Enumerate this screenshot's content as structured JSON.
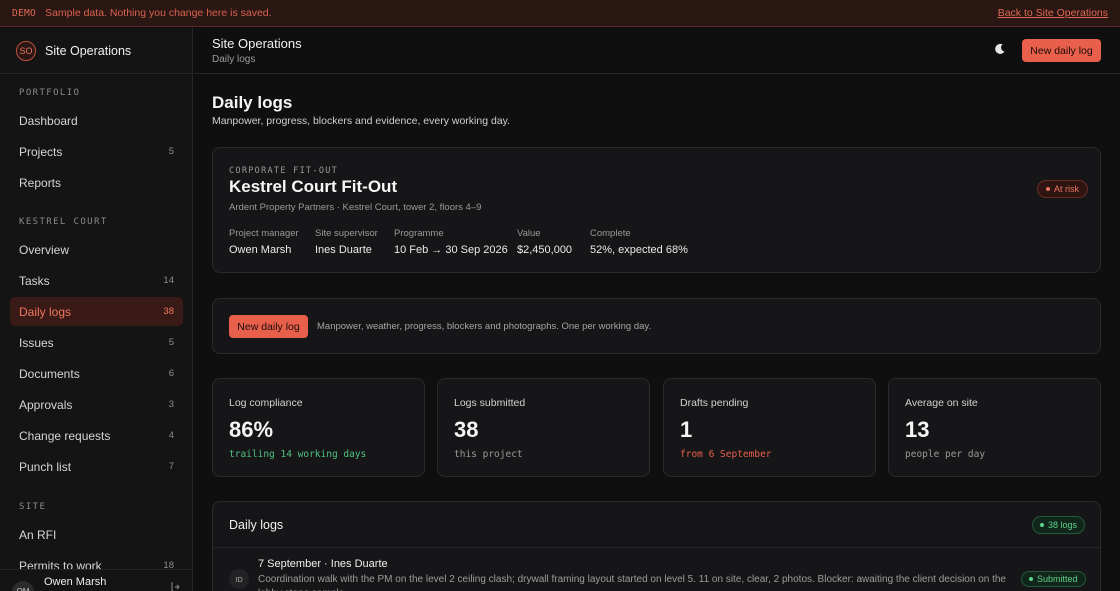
{
  "banner": {
    "tag": "DEMO",
    "message": "Sample data. Nothing you change here is saved.",
    "back_link": "Back to Site Operations"
  },
  "sidebar": {
    "logo_initials": "SO",
    "brand": "Site Operations",
    "sections": [
      {
        "label": "PORTFOLIO",
        "items": [
          {
            "label": "Dashboard",
            "count": ""
          },
          {
            "label": "Projects",
            "count": "5"
          },
          {
            "label": "Reports",
            "count": ""
          }
        ]
      },
      {
        "label": "KESTREL COURT",
        "items": [
          {
            "label": "Overview",
            "count": ""
          },
          {
            "label": "Tasks",
            "count": "14"
          },
          {
            "label": "Daily logs",
            "count": "38",
            "active": true
          },
          {
            "label": "Issues",
            "count": "5"
          },
          {
            "label": "Documents",
            "count": "6"
          },
          {
            "label": "Approvals",
            "count": "3"
          },
          {
            "label": "Change requests",
            "count": "4"
          },
          {
            "label": "Punch list",
            "count": "7"
          }
        ]
      },
      {
        "label": "SITE",
        "items": [
          {
            "label": "An RFI",
            "count": ""
          },
          {
            "label": "Permits to work",
            "count": "18"
          }
        ]
      }
    ],
    "user": {
      "initials": "OM",
      "name": "Owen Marsh",
      "action_icon": "logout-icon"
    }
  },
  "header": {
    "title": "Site Operations",
    "breadcrumb": "Daily logs",
    "theme_icon": "moon-icon",
    "new_log_label": "New daily log"
  },
  "page": {
    "title": "Daily logs",
    "subtitle": "Manpower, progress, blockers and evidence, every working day."
  },
  "project": {
    "kicker": "CORPORATE FIT-OUT",
    "name": "Kestrel Court Fit-Out",
    "client_line": "Ardent Property Partners · Kestrel Court, tower 2, floors 4–9",
    "status": "At risk",
    "meta": [
      {
        "label": "Project manager",
        "value": "Owen Marsh"
      },
      {
        "label": "Site supervisor",
        "value": "Ines Duarte"
      },
      {
        "label": "Programme",
        "value": "10 Feb → 30 Sep 2026"
      },
      {
        "label": "Value",
        "value": "$2,450,000"
      },
      {
        "label": "Complete",
        "value": "52%, expected 68%"
      }
    ]
  },
  "new_log_panel": {
    "button_label": "New daily log",
    "hint": "Manpower, weather, progress, blockers and photographs. One per working day."
  },
  "stats": [
    {
      "label": "Log compliance",
      "value": "86%",
      "note": "trailing 14 working days",
      "tone": "green"
    },
    {
      "label": "Logs submitted",
      "value": "38",
      "note": "this project",
      "tone": ""
    },
    {
      "label": "Drafts pending",
      "value": "1",
      "note": "from 6 September",
      "tone": "red"
    },
    {
      "label": "Average on site",
      "value": "13",
      "note": "people per day",
      "tone": ""
    }
  ],
  "logs": {
    "heading": "Daily logs",
    "count_badge": "38 logs",
    "rows": [
      {
        "initials": "ID",
        "title": "7 September · Ines Duarte",
        "description": "Coordination walk with the PM on the level 2 ceiling clash; drywall framing layout started on level 5. 11 on site, clear, 2 photos. Blocker: awaiting the client decision on the lobby stone sample.",
        "status": "Submitted"
      }
    ]
  }
}
